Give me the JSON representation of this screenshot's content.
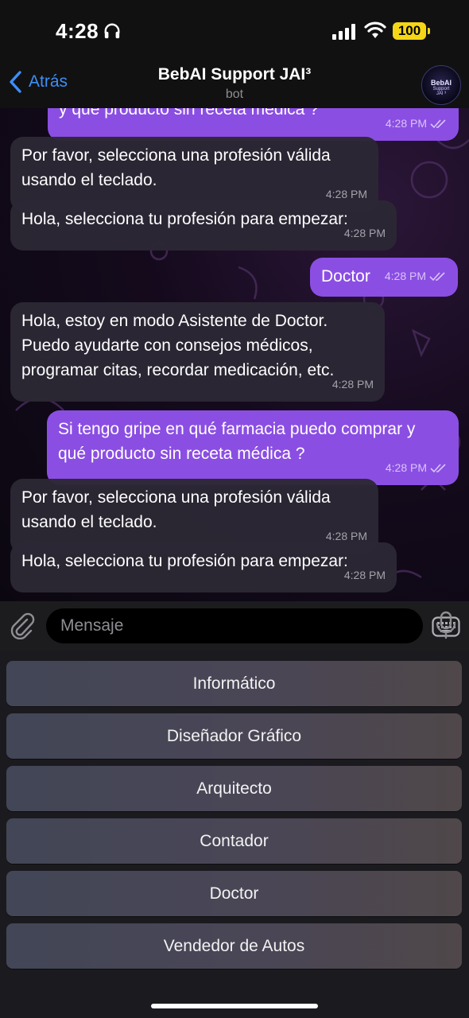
{
  "status_bar": {
    "time": "4:28",
    "battery": "100",
    "accent": "#f5d617"
  },
  "header": {
    "back_label": "Atrás",
    "title": "BebAI Support JAI³",
    "subtitle": "bot",
    "avatar": {
      "line1": "BebAI",
      "line2": "Support",
      "line3": "JAI ³"
    }
  },
  "messages": [
    {
      "dir": "out",
      "text": "y qué producto sin receta médica ?",
      "time": "4:28 PM",
      "read": true
    },
    {
      "dir": "in",
      "text": "Por favor, selecciona una profesión válida usando el teclado.",
      "time": "4:28 PM"
    },
    {
      "dir": "in",
      "text": "Hola, selecciona tu profesión para empezar:",
      "time": "4:28 PM"
    },
    {
      "dir": "out",
      "text": "Doctor",
      "time": "4:28 PM",
      "read": true
    },
    {
      "dir": "in",
      "text": "Hola, estoy en modo Asistente de Doctor. Puedo ayudarte con consejos médicos, programar citas, recordar medicación, etc.",
      "time": "4:28 PM"
    },
    {
      "dir": "out",
      "text": "Si tengo gripe en qué farmacia puedo comprar y qué producto sin receta médica ?",
      "time": "4:28 PM",
      "read": true
    },
    {
      "dir": "in",
      "text": "Por favor, selecciona una profesión válida usando el teclado.",
      "time": "4:28 PM"
    },
    {
      "dir": "in",
      "text": "Hola, selecciona tu profesión para empezar:",
      "time": "4:28 PM"
    }
  ],
  "composer": {
    "placeholder": "Mensaje"
  },
  "keyboard": {
    "buttons": [
      "Informático",
      "Diseñador Gráfico",
      "Arquitecto",
      "Contador",
      "Doctor",
      "Vendedor de Autos"
    ]
  },
  "colors": {
    "link": "#3e8ef7",
    "outgoing_bubble": "#8b4ee3",
    "incoming_bubble": "#2c2834"
  }
}
